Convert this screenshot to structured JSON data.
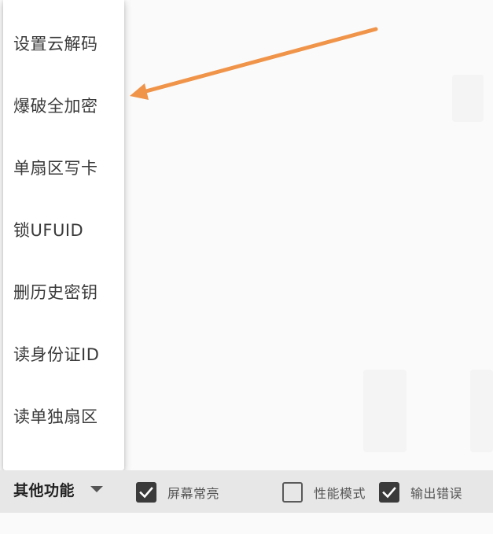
{
  "menu": {
    "items": [
      {
        "label": "设置云解码"
      },
      {
        "label": "爆破全加密"
      },
      {
        "label": "单扇区写卡"
      },
      {
        "label": "锁UFUID"
      },
      {
        "label": "删历史密钥"
      },
      {
        "label": "读身份证ID"
      },
      {
        "label": "读单独扇区"
      }
    ]
  },
  "bottom_bar": {
    "spinner_label": "其他功能",
    "checkboxes": [
      {
        "label": "屏幕常亮",
        "checked": true
      },
      {
        "label": "性能模式",
        "checked": false
      },
      {
        "label": "输出错误",
        "checked": true
      }
    ]
  },
  "annotation": {
    "arrow_color": "#f0944a"
  },
  "colors": {
    "background": "#fafafa",
    "menu_bg": "#ffffff",
    "bar_bg": "#e7e7e7",
    "checkbox_fill": "#3b3b3b"
  }
}
